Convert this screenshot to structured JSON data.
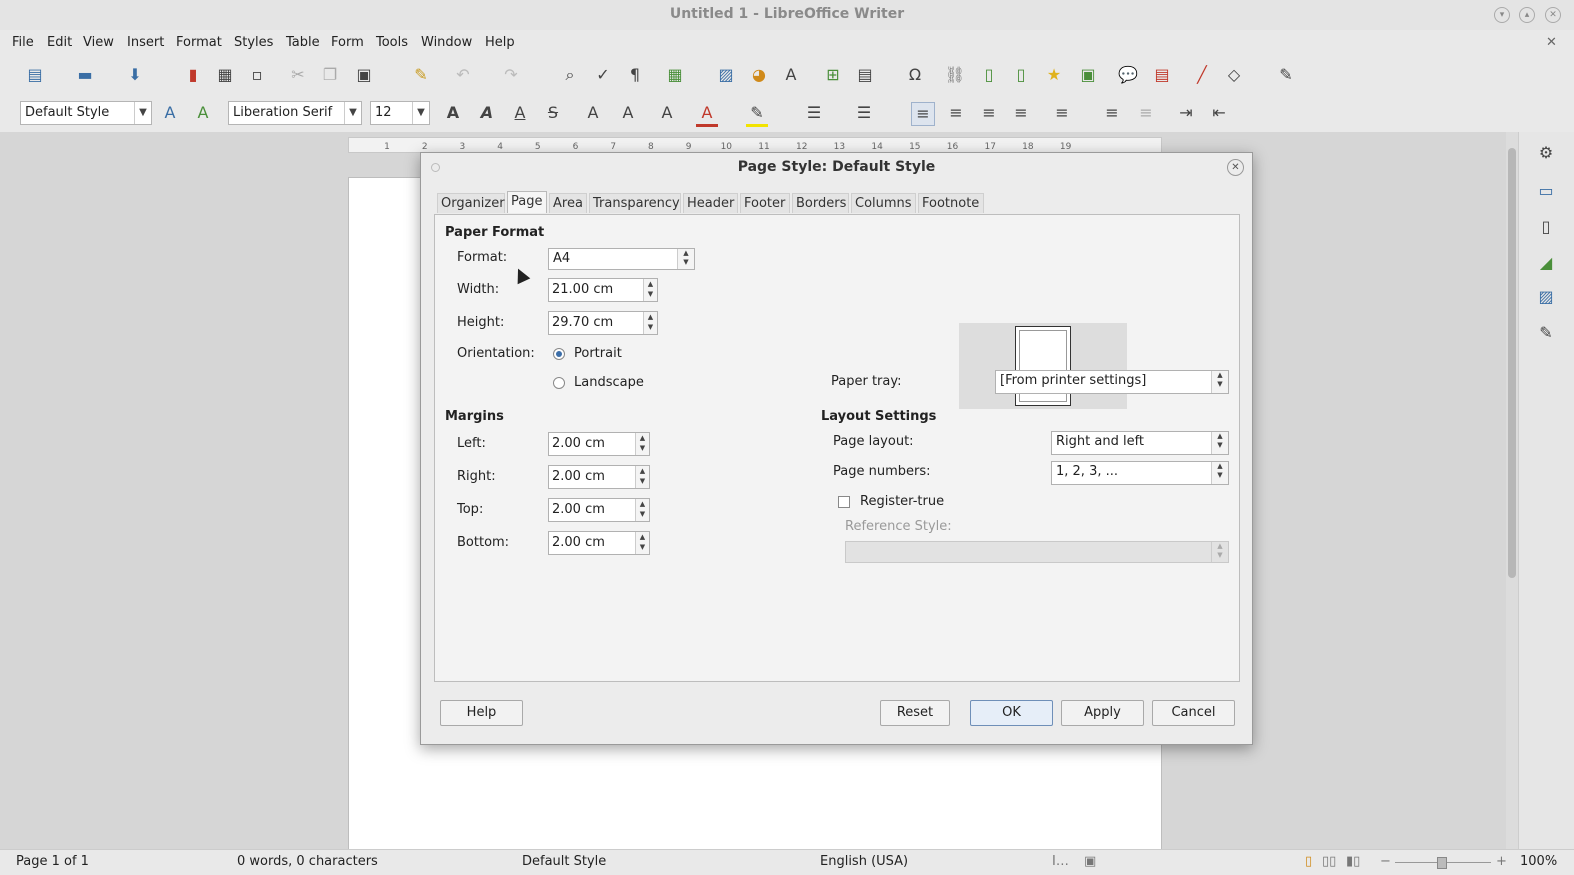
{
  "window": {
    "title": "Untitled 1 - LibreOffice Writer"
  },
  "menu": [
    "File",
    "Edit",
    "View",
    "Insert",
    "Format",
    "Styles",
    "Table",
    "Form",
    "Tools",
    "Window",
    "Help"
  ],
  "toolbar2": {
    "paragraph_style": "Default Style",
    "font_name": "Liberation Serif",
    "font_size": "12"
  },
  "statusbar": {
    "page": "Page 1 of 1",
    "words": "0 words, 0 characters",
    "style": "Default Style",
    "language": "English (USA)",
    "zoom": "100%"
  },
  "ruler": {
    "ticks": [
      "1",
      "2",
      "3",
      "4",
      "5",
      "6",
      "7",
      "8",
      "9",
      "10",
      "11",
      "12",
      "13",
      "14",
      "15",
      "16",
      "17",
      "18",
      "19"
    ]
  },
  "dialog": {
    "title": "Page Style: Default Style",
    "tabs": [
      "Organizer",
      "Page",
      "Area",
      "Transparency",
      "Header",
      "Footer",
      "Borders",
      "Columns",
      "Footnote"
    ],
    "active_tab": "Page",
    "paper_format": {
      "heading": "Paper Format",
      "format_label": "Format:",
      "format_value": "A4",
      "width_label": "Width:",
      "width_value": "21.00 cm",
      "height_label": "Height:",
      "height_value": "29.70 cm",
      "orientation_label": "Orientation:",
      "portrait": "Portrait",
      "landscape": "Landscape",
      "paper_tray_label": "Paper tray:",
      "paper_tray_value": "[From printer settings]"
    },
    "margins": {
      "heading": "Margins",
      "left_label": "Left:",
      "left_value": "2.00 cm",
      "right_label": "Right:",
      "right_value": "2.00 cm",
      "top_label": "Top:",
      "top_value": "2.00 cm",
      "bottom_label": "Bottom:",
      "bottom_value": "2.00 cm"
    },
    "layout": {
      "heading": "Layout Settings",
      "page_layout_label": "Page layout:",
      "page_layout_value": "Right and left",
      "page_numbers_label": "Page numbers:",
      "page_numbers_value": "1, 2, 3, ...",
      "register_true": "Register-true",
      "reference_style_label": "Reference Style:"
    },
    "buttons": {
      "help": "Help",
      "reset": "Reset",
      "ok": "OK",
      "apply": "Apply",
      "cancel": "Cancel"
    }
  }
}
